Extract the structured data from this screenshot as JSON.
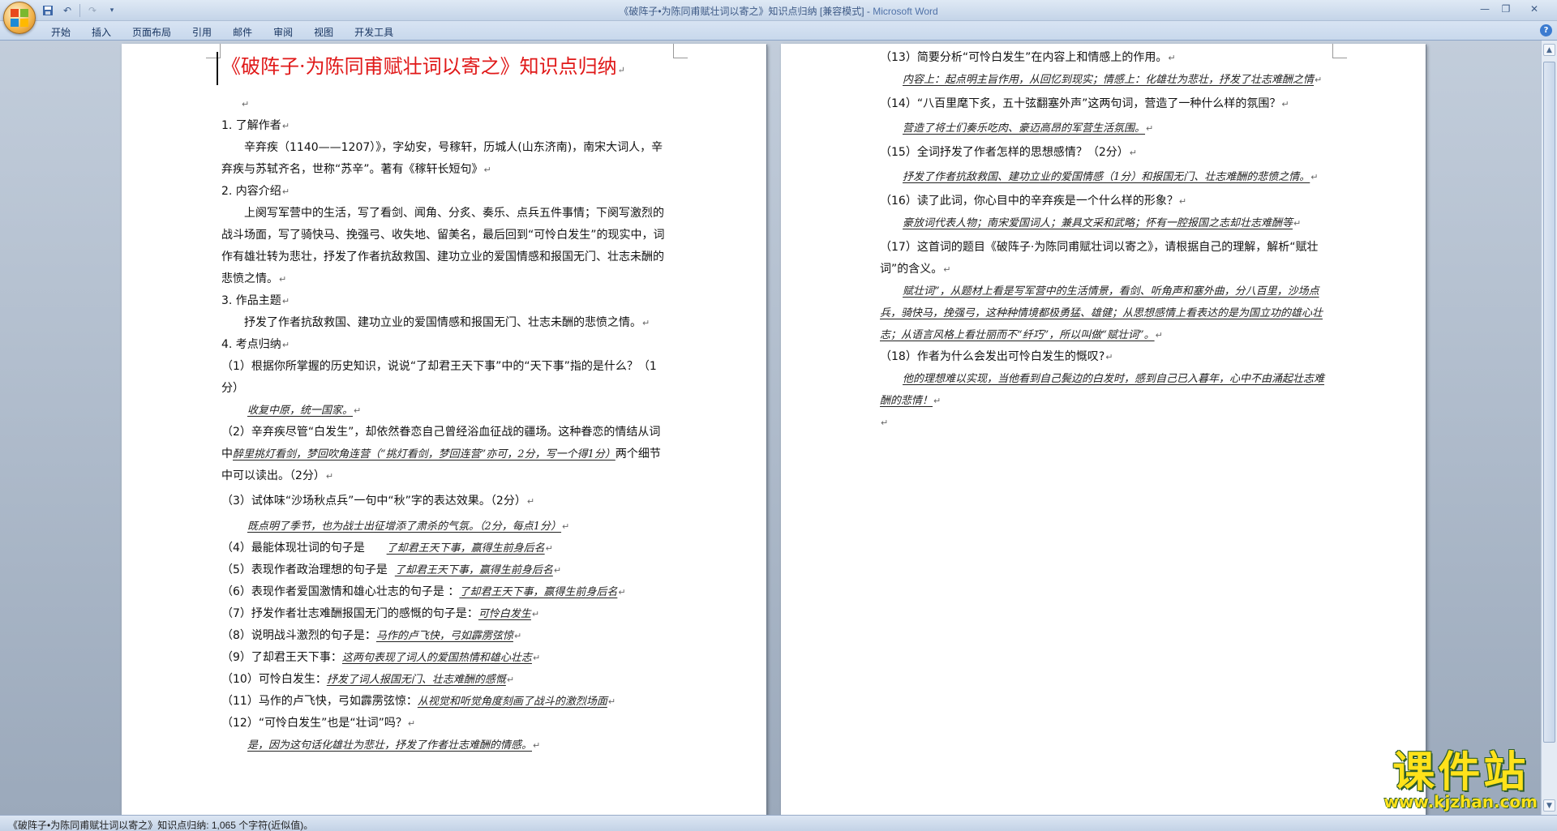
{
  "window": {
    "title": "《破阵子•为陈同甫赋壮词以寄之》知识点归纳 [兼容模式] - ",
    "app": "Microsoft Word"
  },
  "ribbon": {
    "tabs": [
      "开始",
      "插入",
      "页面布局",
      "引用",
      "邮件",
      "审阅",
      "视图",
      "开发工具"
    ]
  },
  "icons": {
    "office": "office-logo-icon",
    "save": "save-icon",
    "undo": "undo-icon",
    "redo": "redo-icon",
    "customize": "chevron-down-icon",
    "help": "help-icon"
  },
  "doc": {
    "title": "《破阵子·为陈同甫赋壮词以寄之》知识点归纳",
    "left": [
      {
        "t": "1. 了解作者",
        "cls": "p"
      },
      {
        "t": "辛弃疾（1140——1207）》，字幼安，号稼轩，历城人(山东济南)，南宋大词人，辛弃疾与苏轼齐名，世称“苏辛”。著有《稼轩长短句》",
        "cls": "p indent"
      },
      {
        "t": "2. 内容介绍",
        "cls": "p"
      },
      {
        "t": "上阕写军营中的生活，写了看剑、闻角、分炙、奏乐、点兵五件事情；下阕写激烈的战斗场面，写了骑快马、挽强弓、收失地、留美名，最后回到“可怜白发生”的现实中，词作有雄壮转为悲壮，抒发了作者抗敌救国、建功立业的爱国情感和报国无门、壮志未酬的悲愤之情。",
        "cls": "p indent"
      },
      {
        "t": "3. 作品主题",
        "cls": "p"
      },
      {
        "t": "抒发了作者抗敌救国、建功立业的爱国情感和报国无门、壮志未酬的悲愤之情。",
        "cls": "p indent"
      },
      {
        "t": "4. 考点归纳",
        "cls": "p"
      }
    ],
    "q1": "（1）根据你所掌握的历史知识，说说“了却君王天下事”中的“天下事”指的是什么？（1分）",
    "a1": "收复中原，统一国家。",
    "q2a": "（2）辛弃疾尽管“白发生”，却依然眷恋自己曾经浴血征战的疆场。这种眷恋的情结从词中",
    "a2": "醉里挑灯看剑，梦回吹角连营（“挑灯看剑，梦回连营”亦可，2分，写一个得1分）",
    "q2b": "两个细节中可以读出。（2分）",
    "q3": "（3）试体味“沙场秋点兵”一句中“秋”字的表达效果。（2分）",
    "a3": "既点明了季节，也为战士出征增添了肃杀的气氛。（2分，每点1分）",
    "q4": "（4）最能体现壮词的句子是",
    "a4": "了却君王天下事，赢得生前身后名",
    "q5": "（5）表现作者政治理想的句子是",
    "a5": "了却君王天下事，赢得生前身后名",
    "q6": "（6）表现作者爱国激情和雄心壮志的句子是  ：",
    "a6": "了却君王天下事，赢得生前身后名",
    "q7": "（7）抒发作者壮志难酬报国无门的感慨的句子是：",
    "a7": "可怜白发生",
    "q8": "（8）说明战斗激烈的句子是：",
    "a8": "马作的卢飞快，弓如霹雳弦惊",
    "q9": "（9）了却君王天下事：",
    "a9": "这两句表现了词人的爱国热情和雄心壮志",
    "q10": "（10）可怜白发生：",
    "a10": "抒发了词人报国无门、壮志难酬的感慨",
    "q11": "（11）马作的卢飞快，弓如霹雳弦惊：",
    "a11": "从视觉和听觉角度刻画了战斗的激烈场面",
    "q12": "（12）“可怜白发生”也是“壮词”吗？",
    "a12": "是，因为这句话化雄壮为悲壮，抒发了作者壮志难酬的情感。",
    "q13": "（13）简要分析“可怜白发生”在内容上和情感上的作用。",
    "a13": "内容上：起点明主旨作用，从回忆到现实；情感上：化雄壮为悲壮，抒发了壮志难酬之情",
    "q14": "（14）“八百里麾下炙，五十弦翻塞外声”这两句词，营造了一种什么样的氛围？",
    "a14": "营造了将士们奏乐吃肉、豪迈高昂的军营生活氛围。",
    "q15": "（15）全词抒发了作者怎样的思想感情？（2分）",
    "a15": "抒发了作者抗敌救国、建功立业的爱国情感（1分）和报国无门、壮志难酬的悲愤之情。",
    "q16": "（16）读了此词，你心目中的辛弃疾是一个什么样的形象？",
    "a16": "豪放词代表人物；南宋爱国词人；兼具文采和武略；怀有一腔报国之志却壮志难酬等",
    "q17": "（17）这首词的题目《破阵子·为陈同甫赋壮词以寄之》，请根据自己的理解，解析“赋壮词”的含义。",
    "a17": "赋壮词”，从题材上看是写军营中的生活情景，看剑、听角声和塞外曲，分八百里，沙场点兵，骑快马，挽强弓，这种种情境都极勇猛、雄健；从思想感情上看表达的是为国立功的雄心壮志；从语言风格上看壮丽而不“纤巧”，所以叫做“赋壮词”。",
    "q18": "（18）作者为什么会发出可怜白发生的慨叹?",
    "a18": "他的理想难以实现，当他看到自己鬓边的白发时，感到自己已入暮年，心中不由涌起壮志难酬的悲情！"
  },
  "status": {
    "text": "《破阵子•为陈同甫赋壮词以寄之》知识点归纳: 1,065 个字符(近似值)。"
  },
  "watermark": {
    "big": "课件站",
    "url": "www.kjzhan.com"
  }
}
